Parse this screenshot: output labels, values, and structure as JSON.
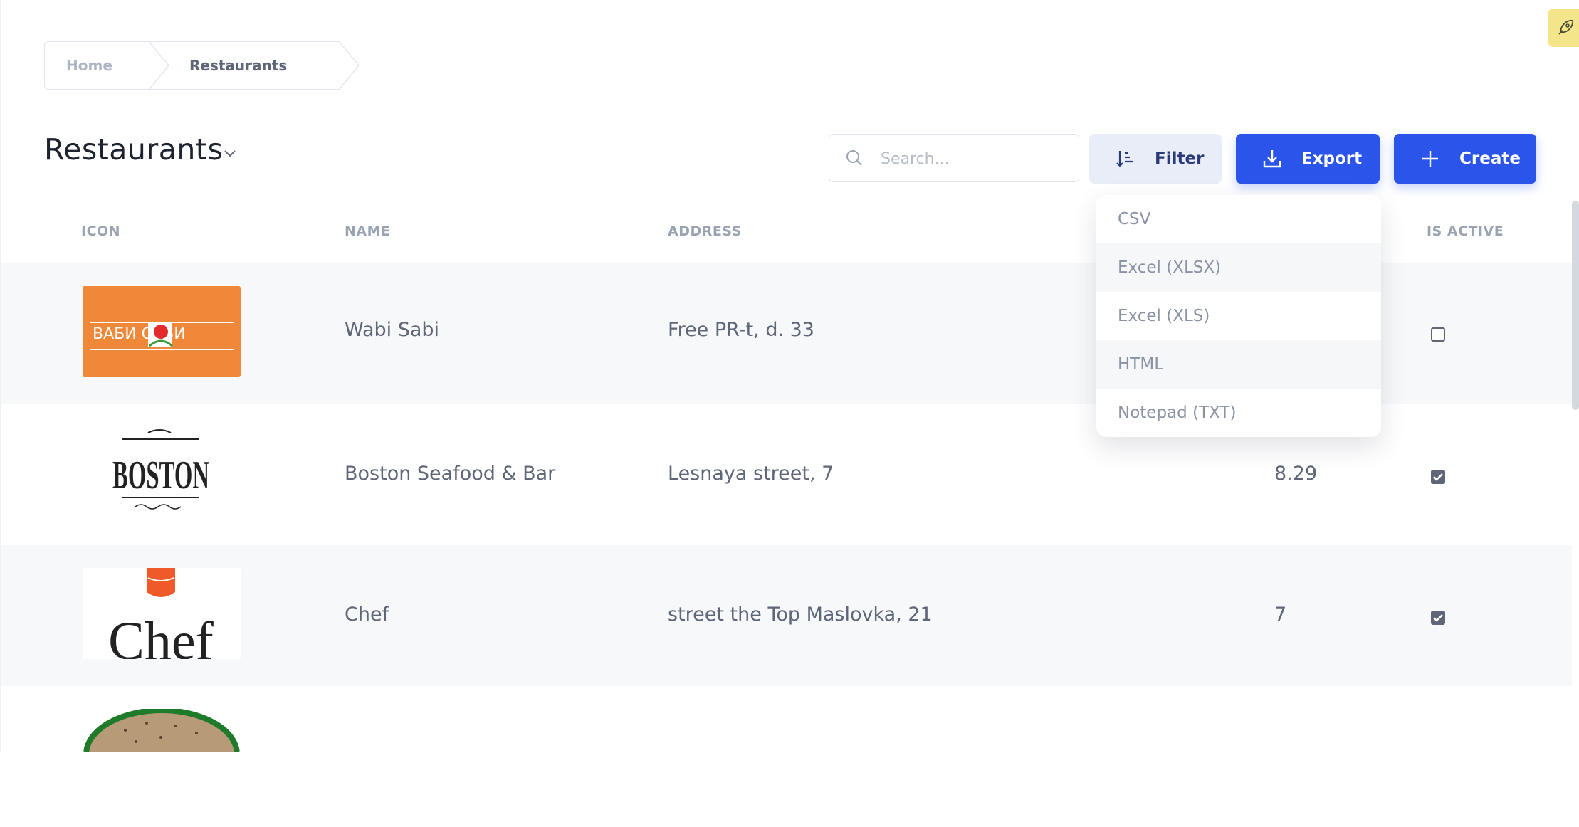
{
  "breadcrumb": {
    "home": "Home",
    "current": "Restaurants"
  },
  "page": {
    "title": "Restaurants"
  },
  "toolbar": {
    "search_placeholder": "Search...",
    "filter_label": "Filter",
    "export_label": "Export",
    "create_label": "Create"
  },
  "export_menu": [
    "CSV",
    "Excel (XLSX)",
    "Excel (XLS)",
    "HTML",
    "Notepad (TXT)"
  ],
  "table": {
    "columns": {
      "icon": "ICON",
      "name": "NAME",
      "address": "ADDRESS",
      "is_active": "IS ACTIVE"
    },
    "rows": [
      {
        "logo": "wabi-sabi-logo",
        "logo_text": "ВАБИ САБИ",
        "name": "Wabi Sabi",
        "address": "Free PR-t, d. 33",
        "rating": "",
        "active": false
      },
      {
        "logo": "boston-logo",
        "logo_text": "BOSTON",
        "name": "Boston Seafood & Bar",
        "address": "Lesnaya street, 7",
        "rating": "8.29",
        "active": true
      },
      {
        "logo": "chef-logo",
        "logo_text": "Chef",
        "name": "Chef",
        "address": "street the Top Maslovka, 21",
        "rating": "7",
        "active": true
      }
    ]
  },
  "colors": {
    "accent": "#2b55ea",
    "filter_bg": "#e8edf7",
    "row_alt": "#f7f8fa",
    "badge": "#f4e58a"
  }
}
